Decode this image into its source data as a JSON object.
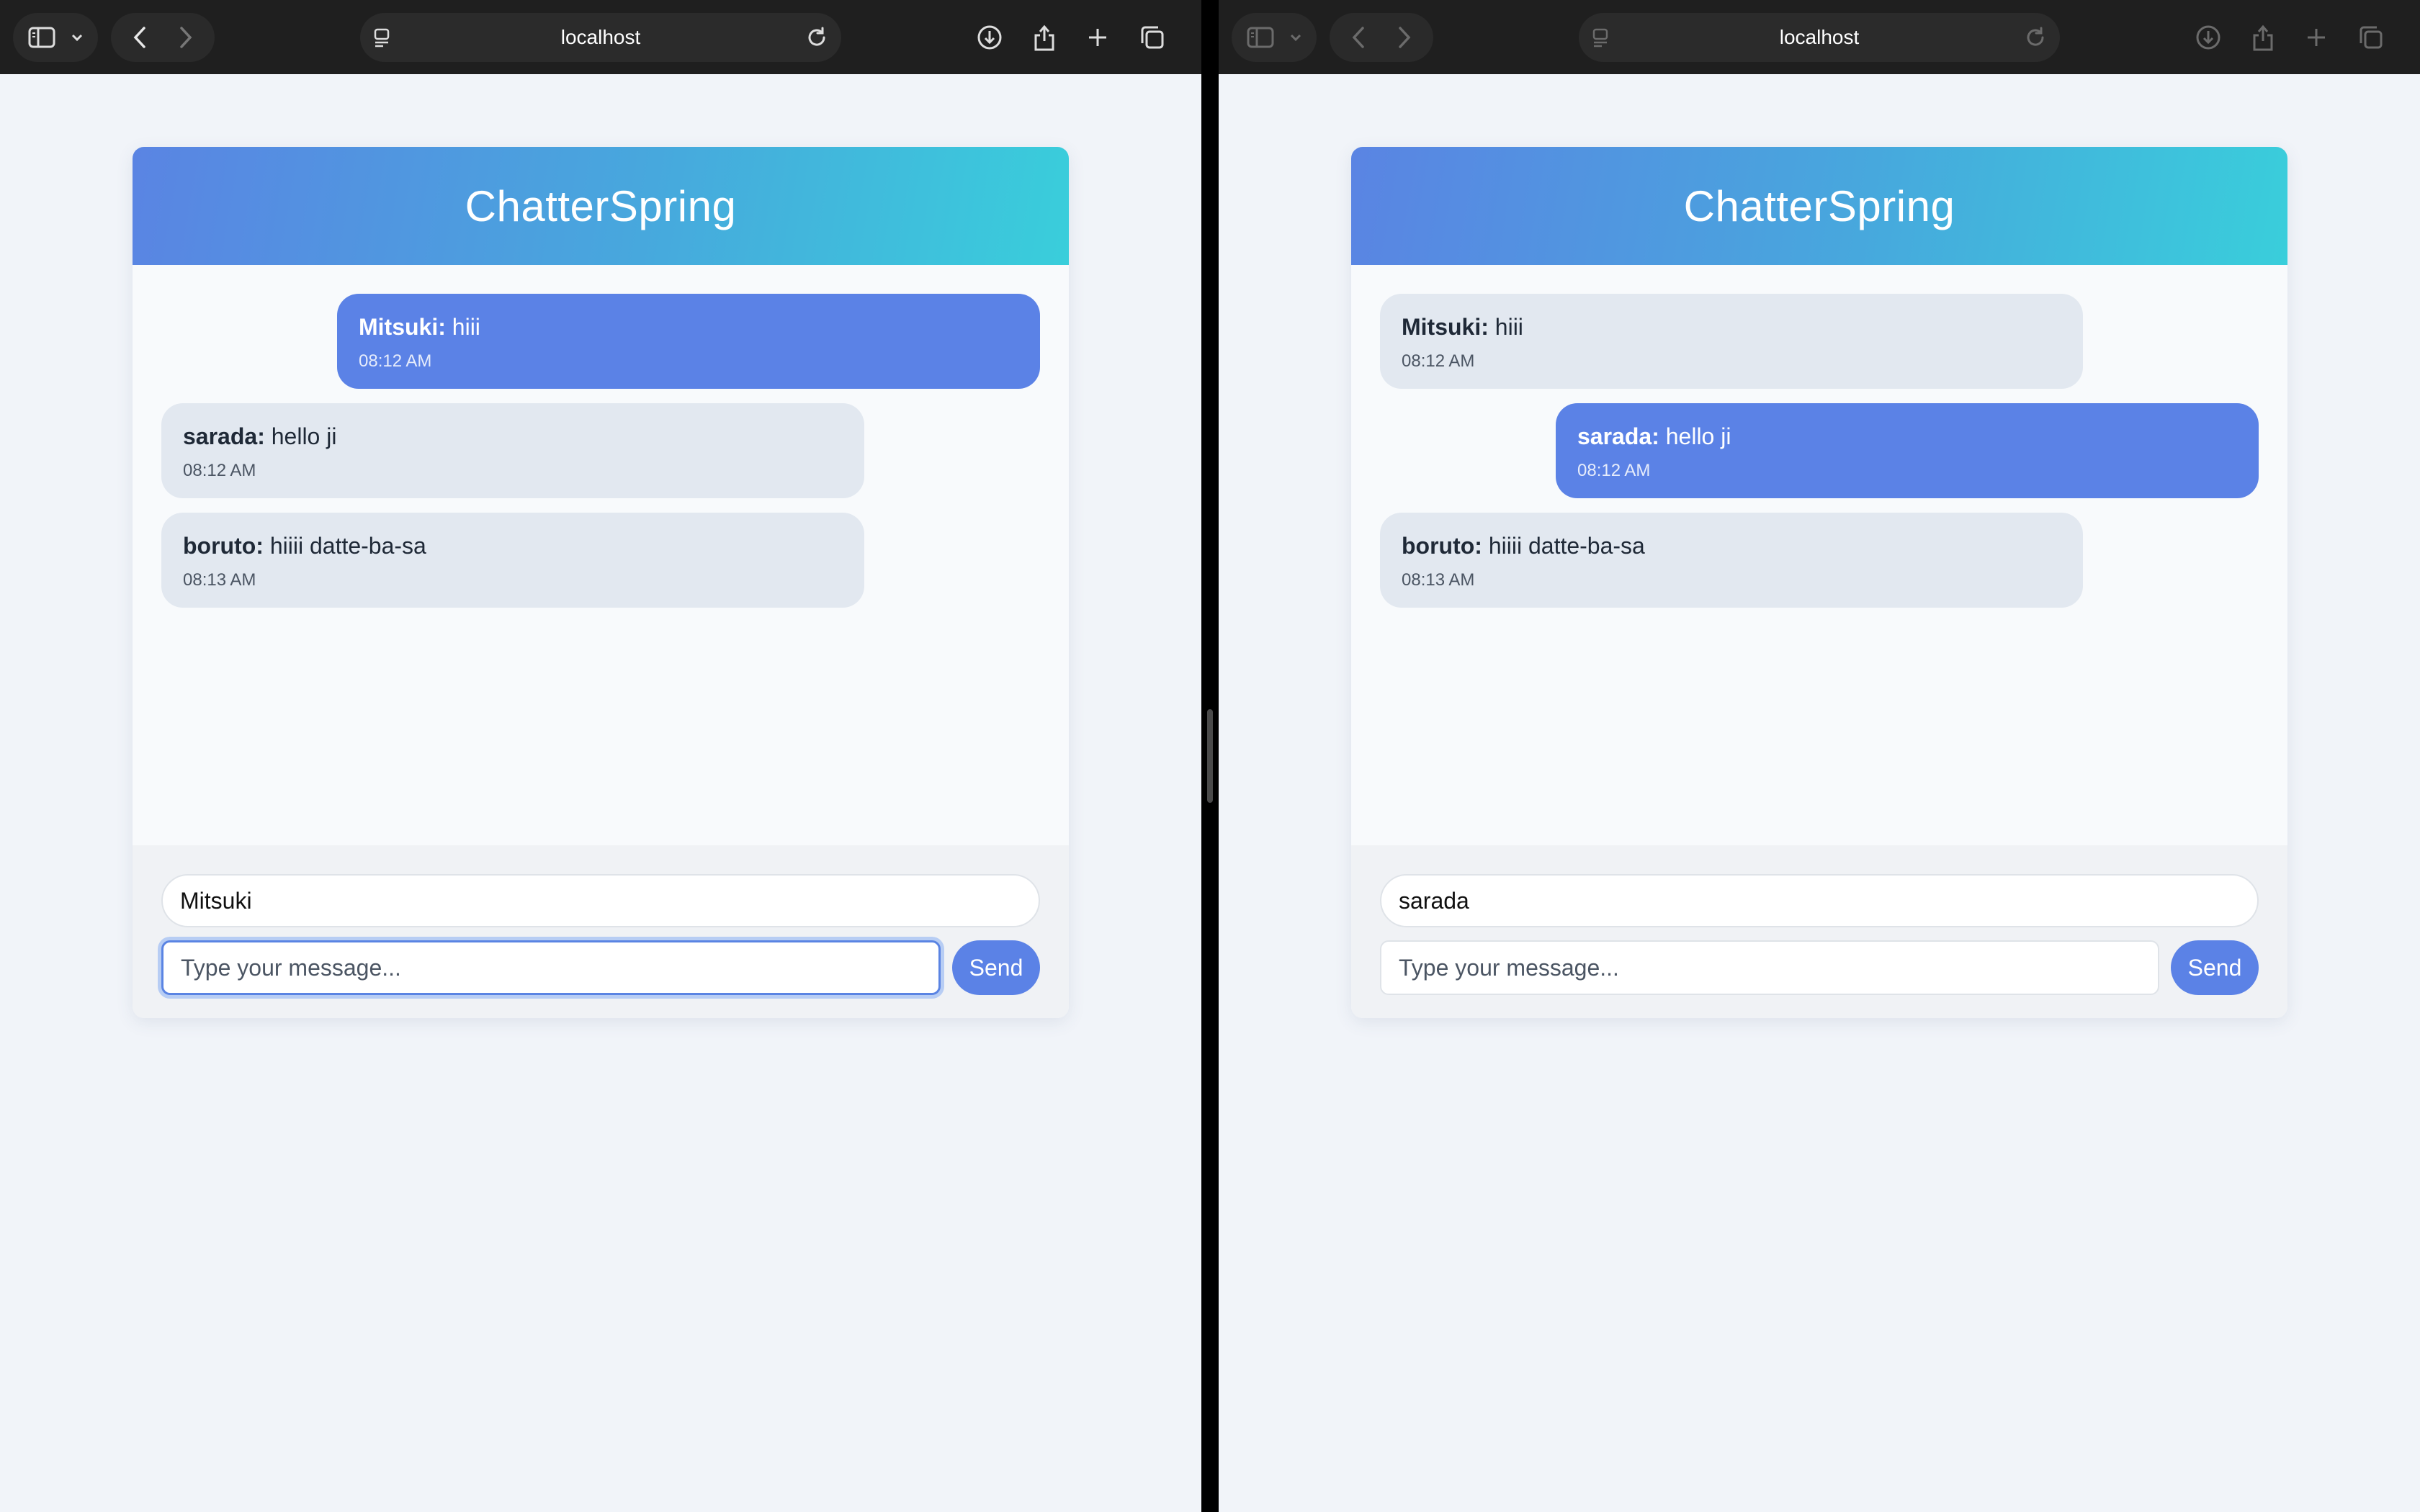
{
  "browser": {
    "url": "localhost"
  },
  "app": {
    "title": "ChatterSpring",
    "send_label": "Send",
    "message_placeholder": "Type your message..."
  },
  "windows": [
    {
      "username": "Mitsuki",
      "messages": [
        {
          "user": "Mitsuki:",
          "text": "hiii",
          "time": "08:12 AM"
        },
        {
          "user": "sarada:",
          "text": "hello ji",
          "time": "08:12 AM"
        },
        {
          "user": "boruto:",
          "text": "hiiii datte-ba-sa",
          "time": "08:13 AM"
        }
      ]
    },
    {
      "username": "sarada",
      "messages": [
        {
          "user": "Mitsuki:",
          "text": "hiii",
          "time": "08:12 AM"
        },
        {
          "user": "sarada:",
          "text": "hello ji",
          "time": "08:12 AM"
        },
        {
          "user": "boruto:",
          "text": "hiiii datte-ba-sa",
          "time": "08:13 AM"
        }
      ]
    }
  ]
}
